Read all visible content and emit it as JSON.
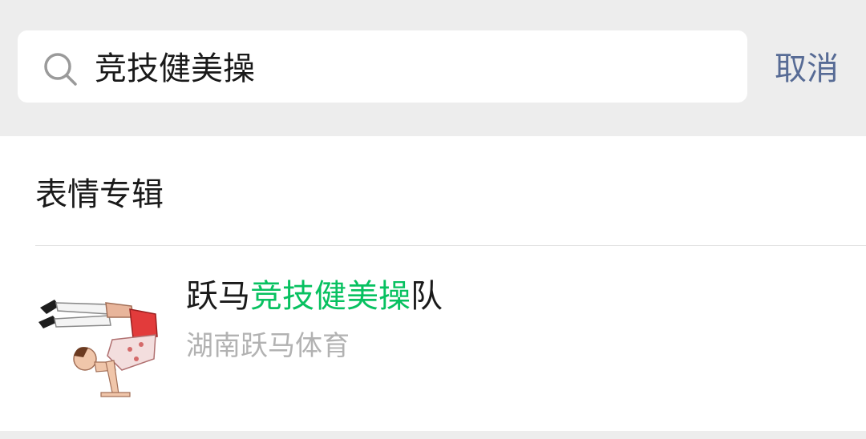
{
  "search": {
    "value": "竞技健美操",
    "placeholder": "",
    "cancel_label": "取消"
  },
  "section": {
    "title": "表情专辑"
  },
  "results": [
    {
      "title_prefix": "跃马",
      "title_highlight": "竞技健美操",
      "title_suffix": "队",
      "subtitle": "湖南跃马体育",
      "thumbnail": "handstand-gymnast-illustration"
    }
  ],
  "colors": {
    "background": "#ededed",
    "accent_highlight": "#07c160",
    "link": "#576b95",
    "primary_text": "#1a1a1a",
    "secondary_text": "#b2b2b2"
  }
}
